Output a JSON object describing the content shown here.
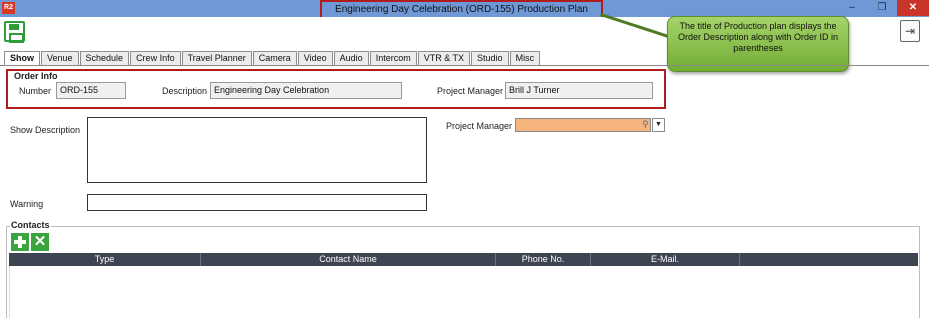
{
  "window": {
    "app_icon": "R2",
    "title": "Engineering Day Celebration (ORD-155)  Production Plan",
    "minimize": "–",
    "maximize": "❐",
    "close": "✕"
  },
  "toolbar": {
    "save_icon": "save-icon",
    "exit_icon": "exit-icon",
    "exit_glyph": "⇥"
  },
  "callout": {
    "text": "The title of Production plan displays the Order Description along with Order ID in parentheses"
  },
  "tabs": [
    {
      "label": "Show"
    },
    {
      "label": "Venue"
    },
    {
      "label": "Schedule"
    },
    {
      "label": "Crew Info"
    },
    {
      "label": "Travel Planner"
    },
    {
      "label": "Camera"
    },
    {
      "label": "Video"
    },
    {
      "label": "Audio"
    },
    {
      "label": "Intercom"
    },
    {
      "label": "VTR & TX"
    },
    {
      "label": "Studio"
    },
    {
      "label": "Misc"
    }
  ],
  "order_info": {
    "legend": "Order Info",
    "number_label": "Number",
    "number_value": "ORD-155",
    "description_label": "Description",
    "description_value": "Engineering Day Celebration",
    "pm_label": "Project Manager",
    "pm_value": "Brill J Turner"
  },
  "show_form": {
    "show_description_label": "Show Description",
    "warning_label": "Warning",
    "pm_label": "Project Manager",
    "pm_search_glyph": "⚲",
    "pm_drop_glyph": "▼"
  },
  "contacts": {
    "legend": "Contacts",
    "delete_glyph": "✕",
    "columns": [
      "Type",
      "Contact Name",
      "Phone No.",
      "E-Mail."
    ]
  }
}
